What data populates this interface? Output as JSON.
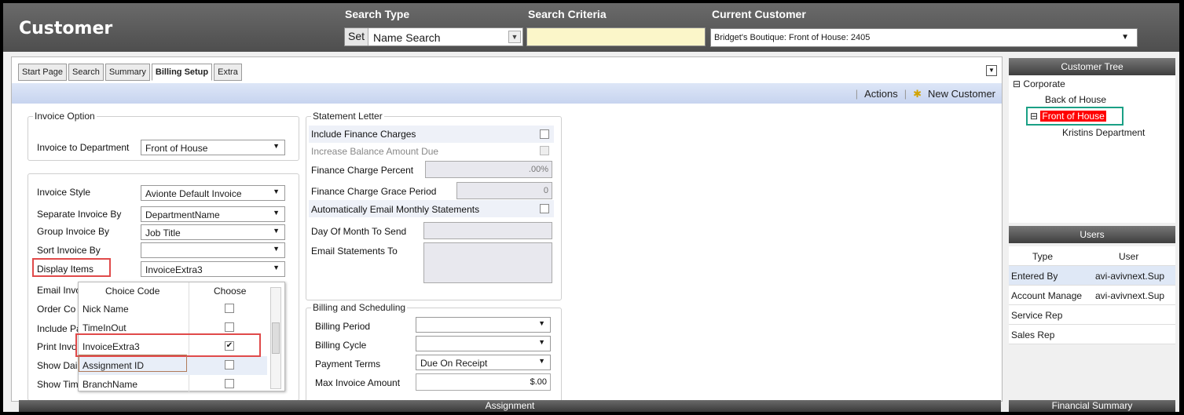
{
  "header": {
    "title": "Customer",
    "search_type_label": "Search Type",
    "search_criteria_label": "Search Criteria",
    "current_customer_label": "Current Customer",
    "set_label": "Set",
    "search_type_value": "Name Search",
    "search_criteria_value": "",
    "current_customer_value": "Bridget's Boutique: Front of House: 2405"
  },
  "tabs": [
    "Start Page",
    "Search",
    "Summary",
    "Billing Setup",
    "Extra"
  ],
  "actions": {
    "actions_label": "Actions",
    "new_customer_label": "New Customer"
  },
  "invoice_option": {
    "legend": "Invoice Option",
    "invoice_to_department_label": "Invoice to Department",
    "invoice_to_department_value": "Front of House",
    "invoice_style_label": "Invoice Style",
    "invoice_style_value": "Avionte Default Invoice",
    "separate_by_label": "Separate Invoice By",
    "separate_by_value": "DepartmentName",
    "group_by_label": "Group Invoice By",
    "group_by_value": "Job Title",
    "sort_by_label": "Sort Invoice By",
    "sort_by_value": "",
    "display_items_label": "Display Items",
    "display_items_value": "InvoiceExtra3",
    "hidden_labels": [
      "Email Invo",
      "Order Co",
      "Include Pa",
      "Print Invo",
      "Show Dai",
      "Show Tim"
    ]
  },
  "popup": {
    "col_choice_code": "Choice Code",
    "col_choose": "Choose",
    "items": [
      {
        "code": "Nick Name",
        "checked": false
      },
      {
        "code": "TimeInOut",
        "checked": false
      },
      {
        "code": "InvoiceExtra3",
        "checked": true
      },
      {
        "code": "Assignment ID",
        "checked": false
      },
      {
        "code": "BranchName",
        "checked": false
      }
    ]
  },
  "statement_letter": {
    "legend": "Statement Letter",
    "include_finance_label": "Include Finance Charges",
    "increase_balance_label": "Increase Balance Amount Due",
    "finance_percent_label": "Finance Charge Percent",
    "finance_percent_value": ".00%",
    "grace_period_label": "Finance Charge Grace Period",
    "grace_period_value": "0",
    "auto_email_label": "Automatically Email Monthly Statements",
    "day_of_month_label": "Day Of Month To Send",
    "email_to_label": "Email Statements To"
  },
  "billing": {
    "legend": "Billing and Scheduling",
    "billing_period_label": "Billing Period",
    "billing_cycle_label": "Billing Cycle",
    "payment_terms_label": "Payment Terms",
    "payment_terms_value": "Due On Receipt",
    "max_invoice_label": "Max Invoice Amount",
    "max_invoice_value": "$.00"
  },
  "customer_tree": {
    "title": "Customer Tree",
    "root": "Corporate",
    "child1": "Back of House",
    "child2": "Front of House",
    "grandchild": "Kristins Department"
  },
  "users": {
    "title": "Users",
    "col_type": "Type",
    "col_user": "User",
    "rows": [
      {
        "type": "Entered By",
        "user": "avi-avivnext.Sup"
      },
      {
        "type": "Account Manage",
        "user": "avi-avivnext.Sup"
      },
      {
        "type": "Service Rep",
        "user": ""
      },
      {
        "type": "Sales Rep",
        "user": ""
      }
    ]
  },
  "bottom": {
    "assignment": "Assignment",
    "financial_summary": "Financial Summary"
  },
  "colors": {
    "header": "#555555",
    "highlight_red": "#e04a4a",
    "tree_selected": "#ff0000",
    "tree_box": "#1aa085"
  }
}
